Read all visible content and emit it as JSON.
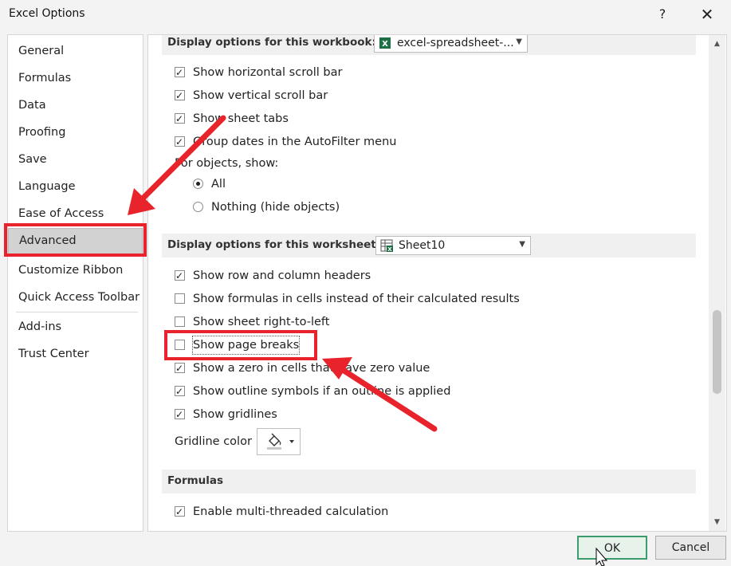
{
  "window": {
    "title": "Excel Options",
    "help_label": "?",
    "close_label": "✕"
  },
  "nav": {
    "items": [
      {
        "label": "General"
      },
      {
        "label": "Formulas"
      },
      {
        "label": "Data"
      },
      {
        "label": "Proofing"
      },
      {
        "label": "Save"
      },
      {
        "label": "Language"
      },
      {
        "label": "Ease of Access"
      },
      {
        "label": "Advanced",
        "selected": true
      },
      {
        "label": "Customize Ribbon"
      },
      {
        "label": "Quick Access Toolbar"
      },
      {
        "label": "Add-ins"
      },
      {
        "label": "Trust Center"
      }
    ]
  },
  "workbook_section": {
    "title": "Display options for this workbook:",
    "combo_value": "excel-spreadsheet-...",
    "options": [
      {
        "label": "Show horizontal scroll bar",
        "checked": true
      },
      {
        "label": "Show vertical scroll bar",
        "checked": true
      },
      {
        "label": "Show sheet tabs",
        "checked": true
      },
      {
        "label": "Group dates in the AutoFilter menu",
        "checked": true
      }
    ],
    "objects_label": "For objects, show:",
    "radio_options": [
      {
        "label": "All",
        "checked": true
      },
      {
        "label": "Nothing (hide objects)",
        "checked": false
      }
    ]
  },
  "worksheet_section": {
    "title": "Display options for this worksheet:",
    "combo_value": "Sheet10",
    "options": [
      {
        "label": "Show row and column headers",
        "checked": true
      },
      {
        "label": "Show formulas in cells instead of their calculated results",
        "checked": false
      },
      {
        "label": "Show sheet right-to-left",
        "checked": false
      },
      {
        "label": "Show page breaks",
        "checked": false
      },
      {
        "label": "Show a zero in cells that have zero value",
        "checked": true
      },
      {
        "label": "Show outline symbols if an outline is applied",
        "checked": true
      },
      {
        "label": "Show gridlines",
        "checked": true
      }
    ],
    "gridline_color_label": "Gridline color"
  },
  "formulas_section": {
    "title": "Formulas",
    "options": [
      {
        "label": "Enable multi-threaded calculation",
        "checked": true
      }
    ]
  },
  "buttons": {
    "ok": "OK",
    "cancel": "Cancel"
  },
  "colors": {
    "annotation": "#e8232b",
    "ok_border": "#3c9c6d",
    "excel_green": "#1d7044"
  }
}
